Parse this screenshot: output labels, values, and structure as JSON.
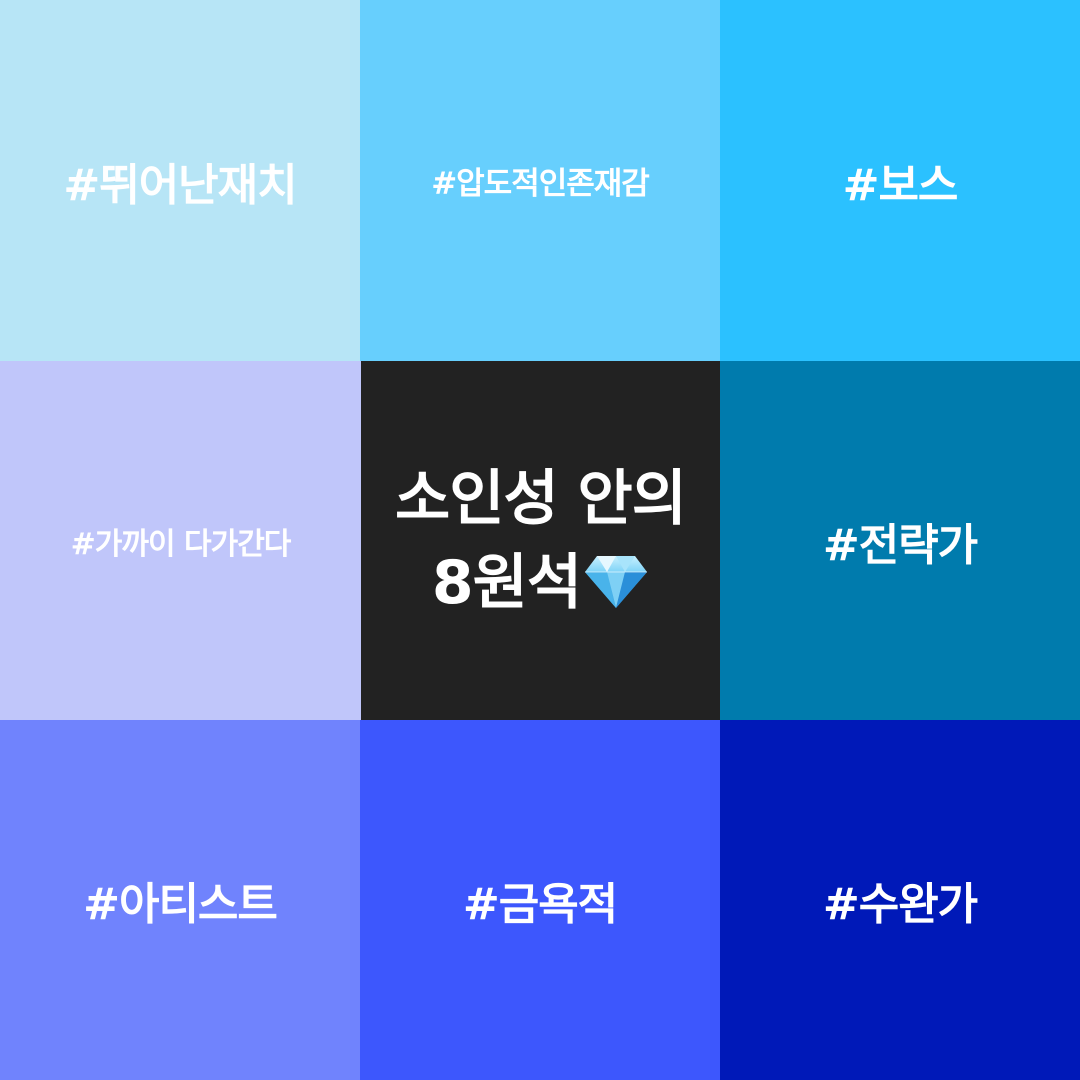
{
  "colors": {
    "tile_1": "#b7e5f6",
    "tile_2": "#67cffd",
    "tile_3": "#2bc1ff",
    "tile_4": "#c0c6fa",
    "tile_5": "#222222",
    "tile_6": "#007bad",
    "tile_7": "#7083fd",
    "tile_8": "#3d57fd",
    "tile_9": "#0019b8",
    "text": "#ffffff"
  },
  "tiles": [
    {
      "label": "#뛰어난재치"
    },
    {
      "label": "#압도적인존재감"
    },
    {
      "label": "#보스"
    },
    {
      "label": "#가까이 다가간다"
    },
    {
      "title_line_1": "소인성 안의",
      "title_line_2": "8원석",
      "icon": "gem-icon"
    },
    {
      "label": "#전략가"
    },
    {
      "label": "#아티스트"
    },
    {
      "label": "#금욕적"
    },
    {
      "label": "#수완가"
    }
  ]
}
